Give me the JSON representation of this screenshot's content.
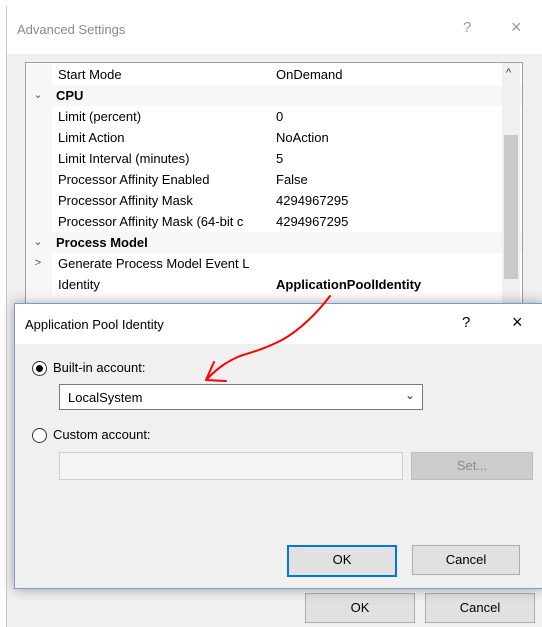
{
  "advanced": {
    "title": "Advanced Settings",
    "help": "?",
    "close": "×",
    "rows": [
      {
        "type": "prop",
        "exp": "",
        "name": "Start Mode",
        "value": "OnDemand"
      },
      {
        "type": "cat",
        "exp": "⌄",
        "name": "CPU",
        "value": ""
      },
      {
        "type": "prop",
        "exp": "",
        "name": "Limit (percent)",
        "value": "0"
      },
      {
        "type": "prop",
        "exp": "",
        "name": "Limit Action",
        "value": "NoAction"
      },
      {
        "type": "prop",
        "exp": "",
        "name": "Limit Interval (minutes)",
        "value": "5"
      },
      {
        "type": "prop",
        "exp": "",
        "name": "Processor Affinity Enabled",
        "value": "False"
      },
      {
        "type": "prop",
        "exp": "",
        "name": "Processor Affinity Mask",
        "value": "4294967295"
      },
      {
        "type": "prop",
        "exp": "",
        "name": "Processor Affinity Mask (64-bit c",
        "value": "4294967295"
      },
      {
        "type": "cat",
        "exp": "⌄",
        "name": "Process Model",
        "value": ""
      },
      {
        "type": "prop",
        "exp": ">",
        "name": "Generate Process Model Event L",
        "value": ""
      },
      {
        "type": "prop",
        "exp": "",
        "name": "Identity",
        "value": "ApplicationPoolIdentity"
      }
    ],
    "ok_label": "OK",
    "cancel_label": "Cancel"
  },
  "dialog": {
    "title": "Application Pool Identity",
    "help": "?",
    "close": "×",
    "builtin_label": "Built-in account:",
    "builtin_value": "LocalSystem",
    "custom_label": "Custom account:",
    "custom_value": "",
    "set_label": "Set...",
    "ok_label": "OK",
    "cancel_label": "Cancel"
  },
  "annotation_color": "#ff0000"
}
